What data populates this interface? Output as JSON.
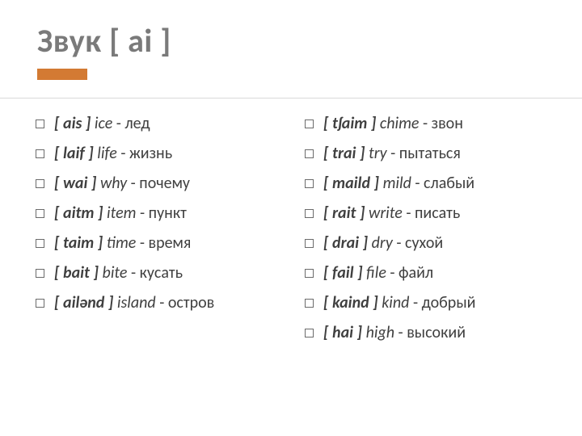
{
  "title": "Звук [ ai ]",
  "left": {
    "items": [
      {
        "tr": "[ ais ]",
        "en": "ice",
        "ru": "лед"
      },
      {
        "tr": "[ laif ]",
        "en": "life",
        "ru": "жизнь"
      },
      {
        "tr": "[ wai ]",
        "en": "why",
        "ru": "почему"
      },
      {
        "tr": "[ aitm ]",
        "en": "item",
        "ru": "пункт"
      },
      {
        "tr": "[ taim ]",
        "en": "time",
        "ru": "время"
      },
      {
        "tr": "[ bait ]",
        "en": "bite",
        "ru": "кусать"
      },
      {
        "tr": "[ ailənd ]",
        "en": "island",
        "ru": "остров"
      }
    ]
  },
  "right": {
    "items": [
      {
        "tr": "[ tʃaim ]",
        "en": "chime",
        "ru": "звон"
      },
      {
        "tr": "[ trai ]",
        "en": "try",
        "ru": "пытаться"
      },
      {
        "tr": "[ maild ]",
        "en": "mild",
        "ru": "слабый"
      },
      {
        "tr": "[ rait ]",
        "en": "write",
        "ru": "писать"
      },
      {
        "tr": "[ drai ]",
        "en": "dry",
        "ru": "сухой"
      },
      {
        "tr": "[ fail ]",
        "en": "file",
        "ru": "файл"
      },
      {
        "tr": "[ kaind ]",
        "en": "kind",
        "ru": "добрый"
      },
      {
        "tr": "[ hai ]",
        "en": "high",
        "ru": "высокий"
      }
    ]
  }
}
